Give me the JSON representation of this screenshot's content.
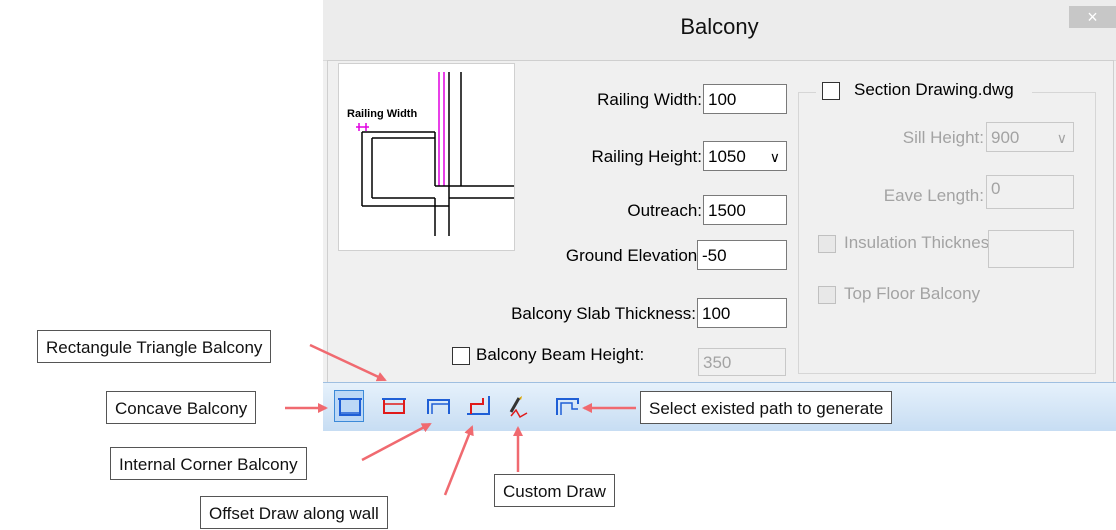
{
  "dialog": {
    "title": "Balcony",
    "close_glyph": "×"
  },
  "preview": {
    "label": "Railing Width"
  },
  "form": {
    "railing_width": {
      "label": "Railing Width:",
      "value": "100"
    },
    "railing_height": {
      "label": "Railing Height:",
      "value": "1050"
    },
    "outreach": {
      "label": "Outreach:",
      "value": "1500"
    },
    "ground_elevation": {
      "label": "Ground Elevation:",
      "value": "-50"
    },
    "slab_thickness": {
      "label": "Balcony Slab Thickness:",
      "value": "100"
    },
    "beam_height": {
      "label": "Balcony Beam Height:",
      "value": "350"
    }
  },
  "section": {
    "checkbox_label": "Section Drawing.dwg",
    "sill_height": {
      "label": "Sill Height:",
      "value": "900"
    },
    "eave_length": {
      "label": "Eave Length:",
      "value": "0"
    },
    "insulation": {
      "label": "Insulation Thickness:",
      "value": ""
    },
    "top_floor": {
      "label": "Top Floor Balcony"
    }
  },
  "callouts": {
    "rect_triangle": "Rectangule Triangle Balcony",
    "concave": "Concave Balcony",
    "internal_corner": "Internal Corner Balcony",
    "offset_draw": "Offset Draw along wall",
    "custom_draw": "Custom Draw",
    "select_path": "Select existed path to generate"
  },
  "icons": {
    "rectangle": "rectangle-balcony-icon",
    "triangle": "rect-triangle-balcony-icon",
    "concave": "concave-balcony-icon",
    "internal_corner": "internal-corner-balcony-icon",
    "custom_draw": "custom-draw-icon",
    "select_path": "select-path-icon"
  },
  "colors": {
    "accent_blue": "#1f5fd6",
    "accent_red": "#e01a1a",
    "callout_arrow": "#f06a70",
    "preview_magenta": "#e000e0"
  }
}
